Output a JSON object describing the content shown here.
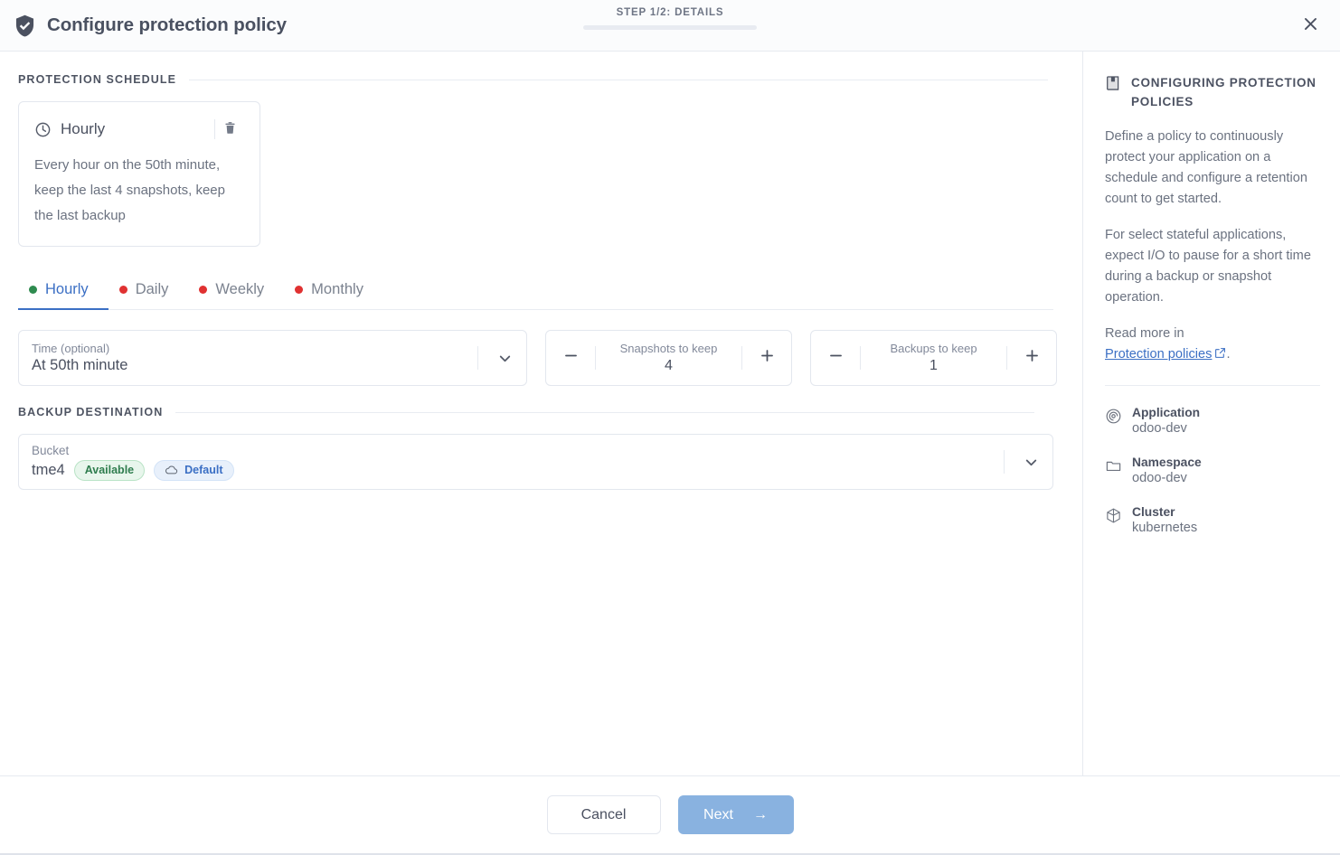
{
  "header": {
    "title": "Configure protection policy",
    "shield_icon": "shield-check-icon",
    "step_label": "STEP 1/2: DETAILS",
    "progress_percent": 50,
    "close_icon": "close-icon"
  },
  "main": {
    "schedule_section_label": "PROTECTION SCHEDULE",
    "schedule_card": {
      "clock_icon": "clock-icon",
      "title": "Hourly",
      "delete_icon": "trash-icon",
      "description": "Every hour on the 50th minute, keep the last 4 snapshots, keep the last backup"
    },
    "tabs": [
      {
        "label": "Hourly",
        "dot_color": "#2e8b4f",
        "active": true
      },
      {
        "label": "Daily",
        "dot_color": "#e03131",
        "active": false
      },
      {
        "label": "Weekly",
        "dot_color": "#e03131",
        "active": false
      },
      {
        "label": "Monthly",
        "dot_color": "#e03131",
        "active": false
      }
    ],
    "time_field": {
      "label": "Time (optional)",
      "value": "At 50th minute",
      "caret_icon": "chevron-down-icon"
    },
    "steppers": [
      {
        "label": "Snapshots to keep",
        "value": "4",
        "minus": "minus-icon",
        "plus": "plus-icon"
      },
      {
        "label": "Backups to keep",
        "value": "1",
        "minus": "minus-icon",
        "plus": "plus-icon"
      }
    ],
    "destination_section_label": "BACKUP DESTINATION",
    "bucket": {
      "label": "Bucket",
      "name": "tme4",
      "status_pill": "Available",
      "default_pill": "Default",
      "cloud_icon": "cloud-icon",
      "caret_icon": "chevron-down-icon"
    }
  },
  "aside": {
    "book_icon": "book-icon",
    "title": "CONFIGURING PROTECTION POLICIES",
    "paragraph_1": "Define a policy to continuously protect your application on a schedule and configure a retention count to get started.",
    "paragraph_2": "For select stateful applications, expect I/O to pause for a short time during a backup or snapshot operation.",
    "read_more_prefix": "Read more in",
    "link_text": "Protection policies",
    "link_suffix": ".",
    "external_icon": "external-link-icon",
    "meta": [
      {
        "icon": "application-icon",
        "label": "Application",
        "value": "odoo-dev"
      },
      {
        "icon": "folder-icon",
        "label": "Namespace",
        "value": "odoo-dev"
      },
      {
        "icon": "cluster-icon",
        "label": "Cluster",
        "value": "kubernetes"
      }
    ]
  },
  "footer": {
    "cancel_label": "Cancel",
    "next_label": "Next",
    "next_arrow": "→",
    "next_enabled": false
  },
  "colors": {
    "accent_blue": "#3b6fc4",
    "next_button": "#89b2e0",
    "available_green": "#2f7d4e",
    "tab_active_red": "#e03131",
    "tab_active_green": "#2e8b4f"
  }
}
